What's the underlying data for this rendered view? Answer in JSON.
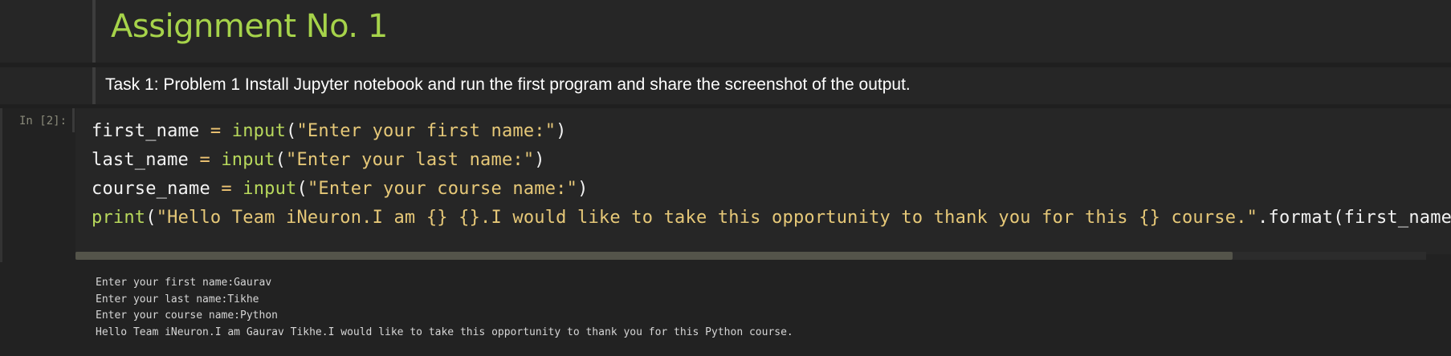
{
  "title_cell": {
    "heading": "Assignment No. 1"
  },
  "markdown_cell": {
    "text": "Task 1: Problem 1 Install Jupyter notebook and run the first program and share the screenshot of the output."
  },
  "code_cell": {
    "prompt": "In [2]:",
    "lines": [
      {
        "var": "first_name",
        "op": " = ",
        "fn": "input",
        "open": "(",
        "str": "\"Enter your first name:\"",
        "close": ")"
      },
      {
        "var": "last_name",
        "op": " = ",
        "fn": "input",
        "open": "(",
        "str": "\"Enter your last name:\"",
        "close": ")"
      },
      {
        "var": "course_name",
        "op": " = ",
        "fn": "input",
        "open": "(",
        "str": "\"Enter your course name:\"",
        "close": ")"
      },
      {
        "fn": "print",
        "open": "(",
        "str": "\"Hello Team iNeuron.I am {} {}.I would like to take this opportunity to thank you for this {} course.\"",
        "rest": ".format(first_name,l"
      }
    ]
  },
  "output": {
    "lines": [
      "Enter your first name:Gaurav",
      "Enter your last name:Tikhe",
      "Enter your course name:Python",
      "Hello Team iNeuron.I am Gaurav Tikhe.I would like to take this opportunity to thank you for this Python course."
    ]
  },
  "scrollbar": {
    "position_fraction": 0.0,
    "visible_fraction": 0.857
  },
  "colors": {
    "heading": "#a6d34a",
    "builtin": "#b8d95c",
    "string": "#e6c878",
    "operator": "#f0c674",
    "background": "#262626"
  }
}
